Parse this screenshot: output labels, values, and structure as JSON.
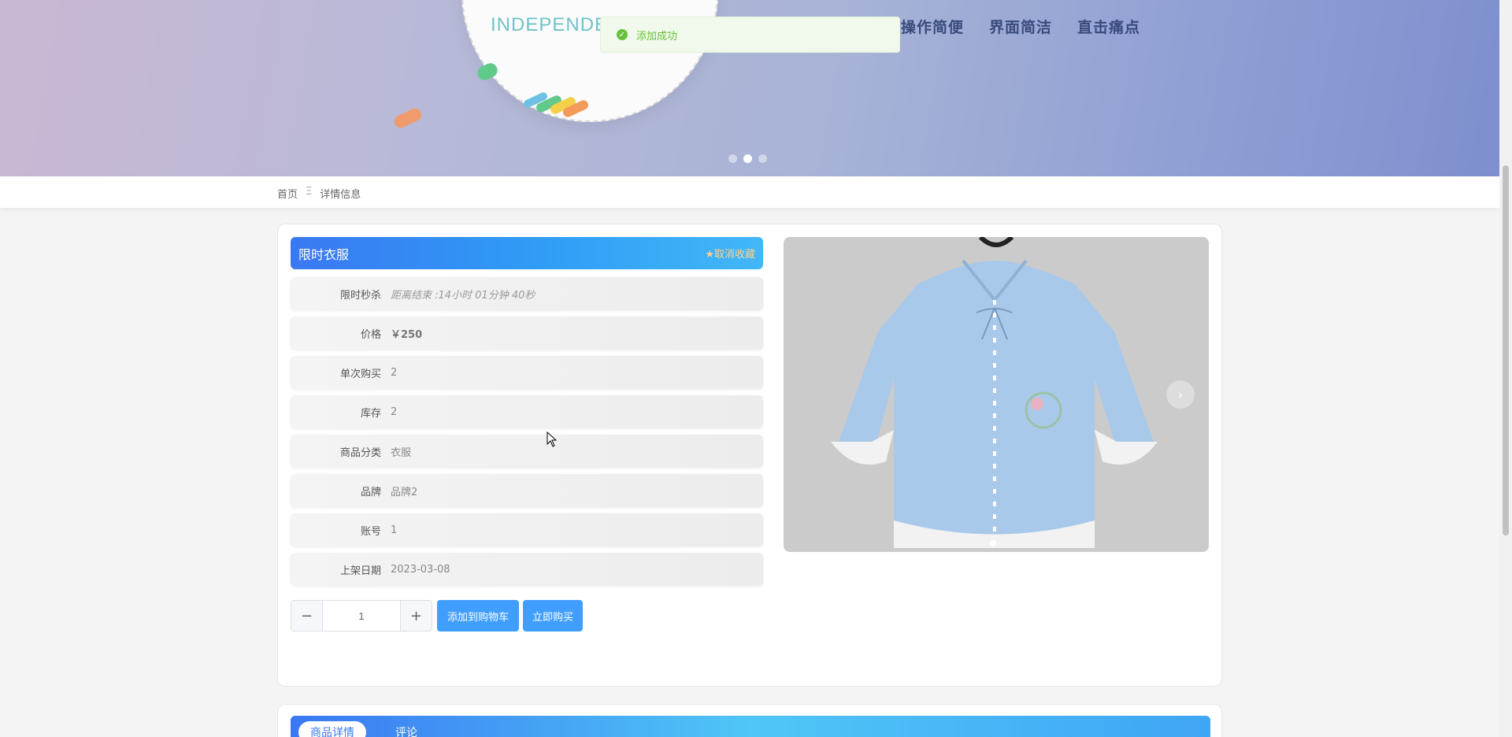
{
  "banner": {
    "partial_text": "INDEPENDEN",
    "slogans": [
      "操作简便",
      "界面简洁",
      "直击痛点"
    ],
    "carousel_dots": 3,
    "active_dot": 2
  },
  "toast": {
    "message": "添加成功"
  },
  "breadcrumb": {
    "home": "首页",
    "separator": "Ξ",
    "current": "详情信息"
  },
  "product": {
    "title": "限时衣服",
    "favorite_label": "★取消收藏",
    "rows": [
      {
        "label": "限时秒杀",
        "value": "距离结束 :14小时 01分钟 40秒"
      },
      {
        "label": "价格",
        "value": "￥250"
      },
      {
        "label": "单次购买",
        "value": "2"
      },
      {
        "label": "库存",
        "value": "2"
      },
      {
        "label": "商品分类",
        "value": "衣服"
      },
      {
        "label": "品牌",
        "value": "品牌2"
      },
      {
        "label": "账号",
        "value": "1"
      },
      {
        "label": "上架日期",
        "value": "2023-03-08"
      }
    ],
    "quantity": "1",
    "add_to_cart_label": "添加到购物车",
    "buy_now_label": "立即购买"
  },
  "tabs": [
    {
      "label": "商品详情",
      "active": true
    },
    {
      "label": "评论",
      "active": false
    }
  ],
  "colors": {
    "primary": "#409eff",
    "success": "#67c23a",
    "title_gradient_start": "#3a78f2",
    "title_gradient_end": "#42b7f8",
    "favorite": "#ffd38a"
  }
}
